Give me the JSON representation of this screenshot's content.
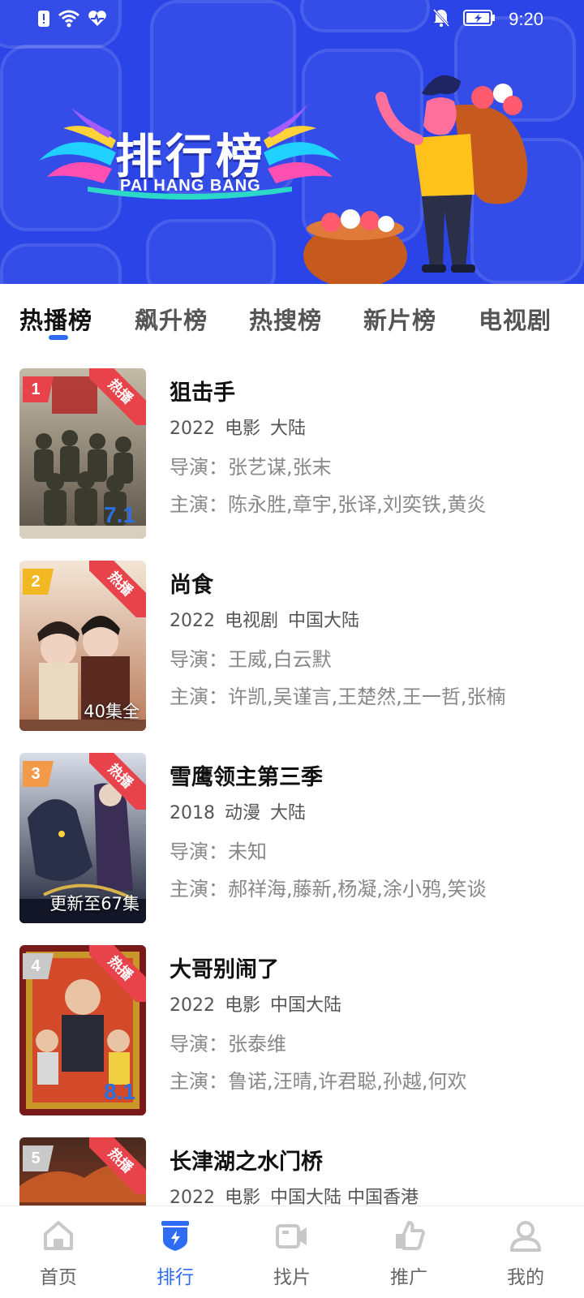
{
  "status": {
    "time": "9:20"
  },
  "banner": {
    "title": "排行榜",
    "subtitle": "PAI HANG BANG"
  },
  "tabs": [
    {
      "label": "热播榜",
      "active": true
    },
    {
      "label": "飙升榜"
    },
    {
      "label": "热搜榜"
    },
    {
      "label": "新片榜"
    },
    {
      "label": "电视剧"
    }
  ],
  "labels": {
    "director": "导演：",
    "cast": "主演："
  },
  "items": [
    {
      "rank": "1",
      "rank_color": "#e8434a",
      "hot": "热播",
      "title": "狙击手",
      "year": "2022",
      "type": "电影",
      "region": "大陆",
      "director": "张艺谋,张末",
      "cast": "陈永胜,章宇,张译,刘奕铁,黄炎",
      "episode": ""
    },
    {
      "rank": "2",
      "rank_color": "#f2b821",
      "hot": "热播",
      "title": "尚食",
      "year": "2022",
      "type": "电视剧",
      "region": "中国大陆",
      "director": "王威,白云默",
      "cast": "许凯,吴谨言,王楚然,王一哲,张楠",
      "episode": "40集全"
    },
    {
      "rank": "3",
      "rank_color": "#f29a4a",
      "hot": "热播",
      "title": "雪鹰领主第三季",
      "year": "2018",
      "type": "动漫",
      "region": "大陆",
      "director": "未知",
      "cast": "郝祥海,藤新,杨凝,涂小鸦,笑谈",
      "episode": "更新至67集"
    },
    {
      "rank": "4",
      "rank_color": "#c9c9c9",
      "hot": "热播",
      "title": "大哥别闹了",
      "year": "2022",
      "type": "电影",
      "region": "中国大陆",
      "director": "张泰维",
      "cast": "鲁诺,汪晴,许君聪,孙越,何欢",
      "episode": ""
    },
    {
      "rank": "5",
      "rank_color": "#c9c9c9",
      "hot": "热播",
      "title": "长津湖之水门桥",
      "year": "2022",
      "type": "电影",
      "region": "中国大陆 中国香港",
      "director": "",
      "cast": "",
      "episode": ""
    }
  ],
  "nav": [
    {
      "label": "首页",
      "icon": "home-icon"
    },
    {
      "label": "排行",
      "icon": "ranking-shield-icon",
      "active": true
    },
    {
      "label": "找片",
      "icon": "video-camera-icon"
    },
    {
      "label": "推广",
      "icon": "thumbs-up-icon"
    },
    {
      "label": "我的",
      "icon": "person-icon"
    }
  ],
  "colors": {
    "banner": "#2a44e8",
    "accent": "#2f6cf6",
    "hot": "#e8434a"
  }
}
